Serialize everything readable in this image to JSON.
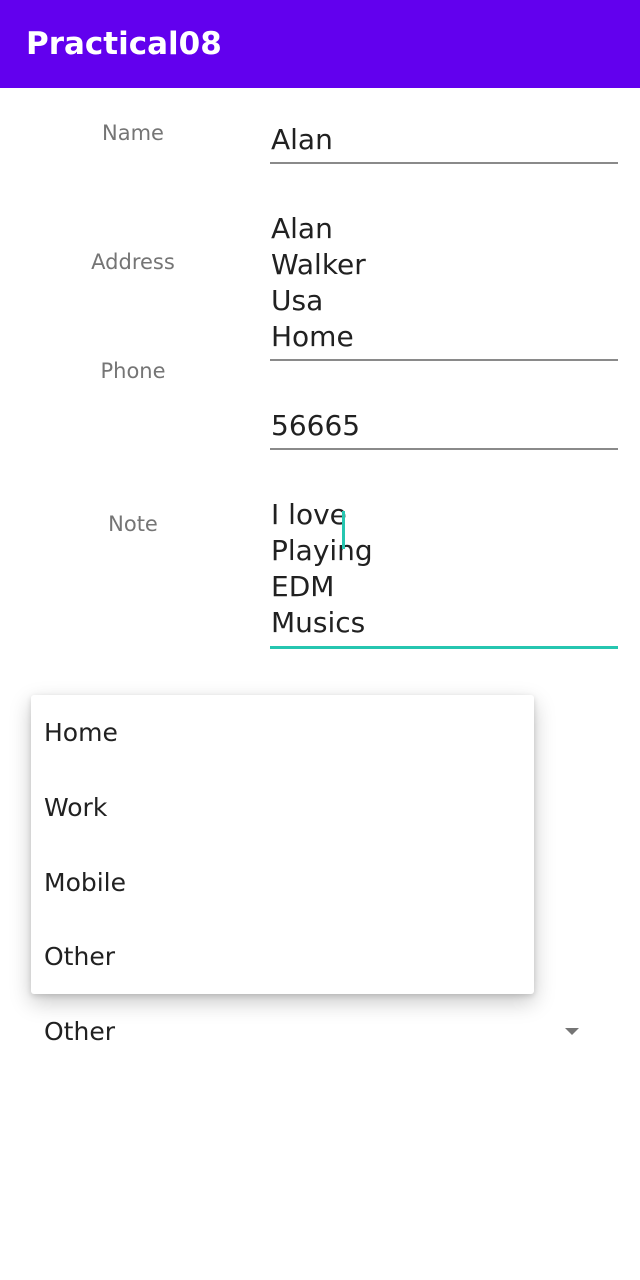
{
  "appbar": {
    "title": "Practical08",
    "color": "#6200EE"
  },
  "form": {
    "name": {
      "label": "Name",
      "value": "Alan"
    },
    "address": {
      "label": "Address",
      "value": "Alan\nWalker\nUsa\nHome"
    },
    "phone": {
      "label": "Phone",
      "value": "56665"
    },
    "note": {
      "label": "Note",
      "value": "I love\nPlaying\nEDM\nMusics",
      "focus_color": "#26C6B0"
    }
  },
  "spinner": {
    "selected": "Other",
    "icon": "dropdown-arrow-icon",
    "options": [
      "Home",
      "Work",
      "Mobile",
      "Other"
    ]
  }
}
